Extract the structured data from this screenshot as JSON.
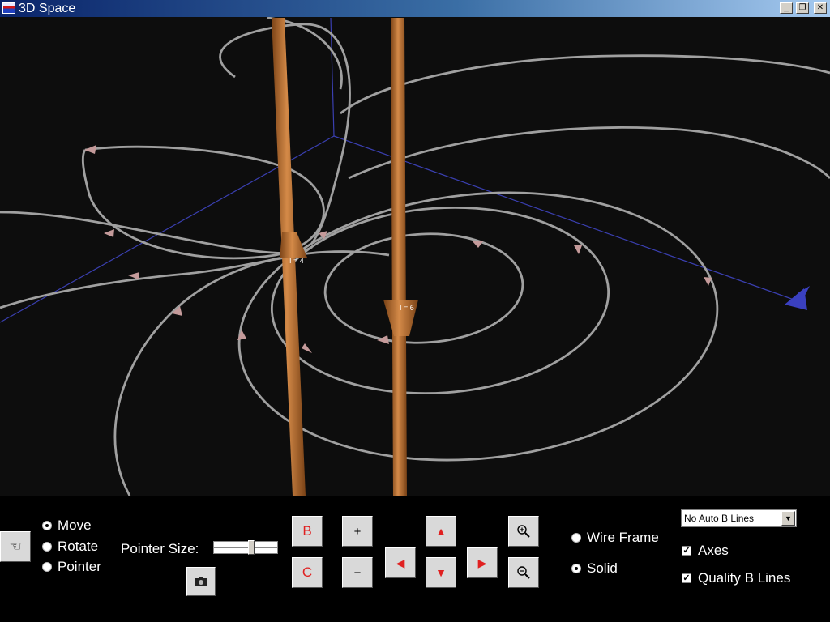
{
  "window": {
    "title": "3D Space"
  },
  "titlebar_buttons": {
    "minimize": "_",
    "restore": "❐",
    "close": "✕"
  },
  "viewport": {
    "wire_label_right": "I = 6",
    "wire_label_left": "I = 4"
  },
  "controls": {
    "mode_options": [
      {
        "label": "Move",
        "selected": true
      },
      {
        "label": "Rotate",
        "selected": false
      },
      {
        "label": "Pointer",
        "selected": false
      }
    ],
    "pointer_size_label": "Pointer Size:",
    "pointer_size_level": 0.6,
    "b_button": "B",
    "c_button": "C",
    "plus_button": "+",
    "minus_button": "−",
    "arrow_up": "▲",
    "arrow_down": "▼",
    "arrow_left": "◀",
    "arrow_right": "▶",
    "zoom_in_icon": "zoom-in-icon",
    "zoom_out_icon": "zoom-out-icon",
    "render_options": [
      {
        "label": "Wire Frame",
        "selected": false
      },
      {
        "label": "Solid",
        "selected": true
      }
    ],
    "auto_b_lines": {
      "selected": "No Auto B Lines"
    },
    "axes": {
      "label": "Axes",
      "checked": true
    },
    "quality_b_lines": {
      "label": "Quality B Lines",
      "checked": true
    }
  },
  "colors": {
    "wire": "#b0652a",
    "field_line": "#a0a0a0",
    "axes": "#3a3fb0",
    "background": "#0d0d0d",
    "arrow_cone": "#c49a9a"
  }
}
